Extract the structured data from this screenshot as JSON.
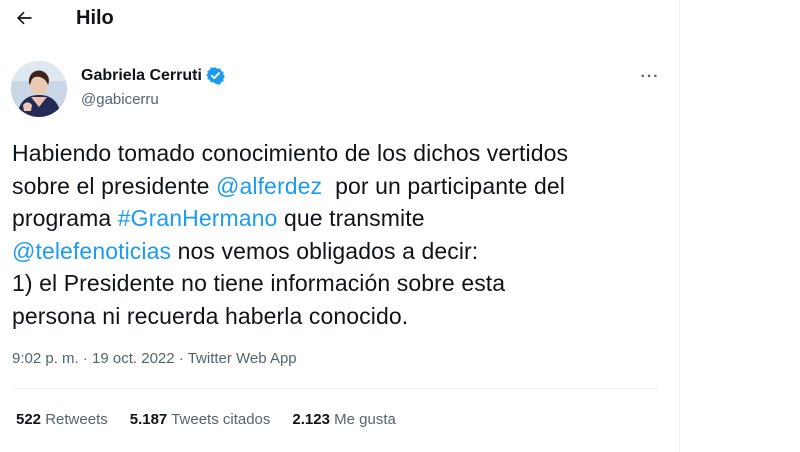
{
  "header": {
    "title": "Hilo",
    "back_icon": "arrow-left-icon"
  },
  "author": {
    "name": "Gabriela Cerruti",
    "handle": "@gabicerru",
    "verified_icon": "verified-badge-icon",
    "verified_color": "#1d9bf0",
    "more_icon": "more-horizontal-icon",
    "more_label": "···"
  },
  "tweet": {
    "line1": "Habiendo tomado conocimiento de los dichos vertidos",
    "line2_pre": "sobre el presidente ",
    "mention1": "@alferdez",
    "line2_post": "  por un participante del",
    "line3_pre": "programa ",
    "hashtag": "#GranHermano",
    "line3_post": " que transmite",
    "mention2": "@telefenoticias",
    "line4_post": " nos vemos obligados a decir:",
    "line5": "1) el Presidente no tiene información sobre esta",
    "line6": "persona ni recuerda haberla conocido."
  },
  "meta": {
    "time": "9:02 p. m.",
    "sep": " · ",
    "date": "19 oct. 2022",
    "source": "Twitter Web App"
  },
  "stats": {
    "retweets_count": "522",
    "retweets_label": "Retweets",
    "quotes_count": "5.187",
    "quotes_label": "Tweets citados",
    "likes_count": "2.123",
    "likes_label": "Me gusta"
  },
  "colors": {
    "link": "#1d9bf0",
    "text": "#0f1419",
    "secondary": "#536471"
  }
}
